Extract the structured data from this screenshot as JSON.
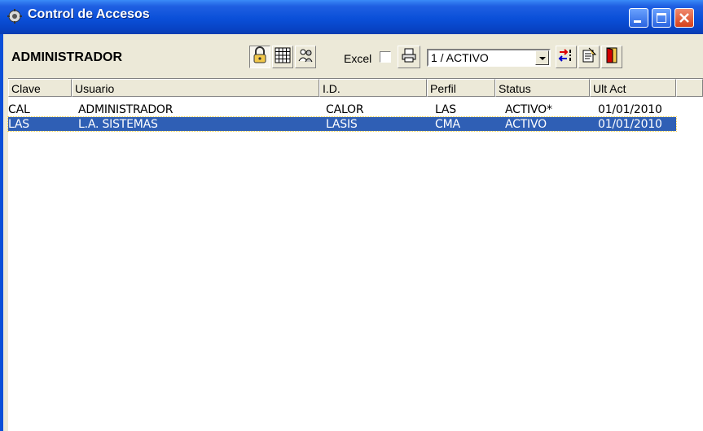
{
  "window": {
    "title": "Control de Accesos",
    "accent": "#0a4fd8",
    "close_color": "#d6401b"
  },
  "toolbar": {
    "user": "ADMINISTRADOR",
    "icons": [
      "lock-icon",
      "grid-icon",
      "users-icon",
      "printer-icon",
      "sort-icon",
      "export-icon",
      "exit-door-icon"
    ],
    "excel_label": "Excel",
    "excel_checked": false,
    "filter_value": "1 / ACTIVO"
  },
  "grid": {
    "columns": [
      "Clave",
      "Usuario",
      "I.D.",
      "Perfil",
      "Status",
      "Ult Act"
    ],
    "rows": [
      [
        "CAL",
        "ADMINISTRADOR",
        "CALOR",
        "LAS",
        "ACTIVO*",
        "01/01/2010"
      ],
      [
        "LAS",
        "L.A. SISTEMAS",
        "LASIS",
        "CMA",
        "ACTIVO",
        "01/01/2010"
      ]
    ],
    "selected_row": 1,
    "selection_color": "#2f5fb5"
  }
}
